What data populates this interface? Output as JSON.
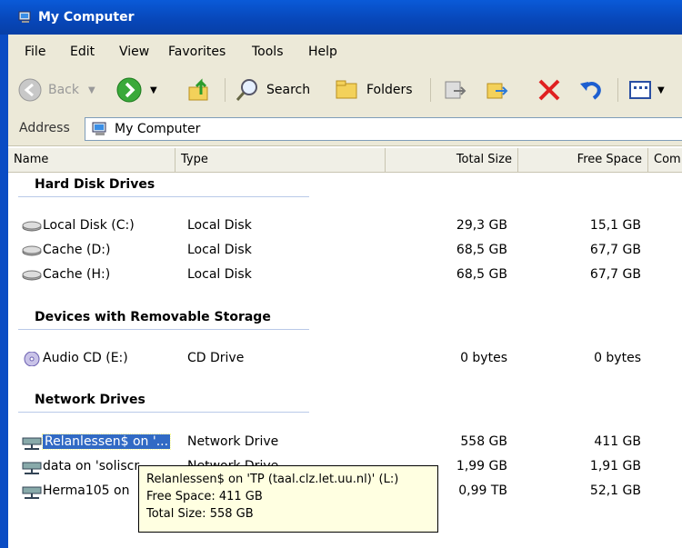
{
  "window": {
    "title": "My Computer"
  },
  "menu": [
    "File",
    "Edit",
    "View",
    "Favorites",
    "Tools",
    "Help"
  ],
  "toolbar": {
    "back": "Back",
    "search": "Search",
    "folders": "Folders"
  },
  "address": {
    "label": "Address",
    "value": "My Computer"
  },
  "columns": [
    "Name",
    "Type",
    "Total Size",
    "Free Space",
    "Com"
  ],
  "groups": {
    "hard": "Hard Disk Drives",
    "removable": "Devices with Removable Storage",
    "network": "Network Drives"
  },
  "hard_drives": [
    {
      "name": "Local Disk (C:)",
      "type": "Local Disk",
      "total": "29,3 GB",
      "free": "15,1 GB"
    },
    {
      "name": "Cache (D:)",
      "type": "Local Disk",
      "total": "68,5 GB",
      "free": "67,7 GB"
    },
    {
      "name": "Cache (H:)",
      "type": "Local Disk",
      "total": "68,5 GB",
      "free": "67,7 GB"
    }
  ],
  "removable": [
    {
      "name": "Audio CD (E:)",
      "type": "CD Drive",
      "total": "0 bytes",
      "free": "0 bytes"
    }
  ],
  "network_drives": [
    {
      "name": "Relanlessen$ on '...",
      "type": "Network Drive",
      "total": "558 GB",
      "free": "411 GB"
    },
    {
      "name": "data on 'soliscr...",
      "type": "Network Drive",
      "total": "1,99 GB",
      "free": "1,91 GB"
    },
    {
      "name": "Herma105 on",
      "type": "",
      "total": "0,99 TB",
      "free": "52,1 GB"
    }
  ],
  "tooltip": {
    "line1": "Relanlessen$ on 'TP (taal.clz.let.uu.nl)' (L:)",
    "line2": "Free Space: 411 GB",
    "line3": "Total Size: 558 GB"
  }
}
